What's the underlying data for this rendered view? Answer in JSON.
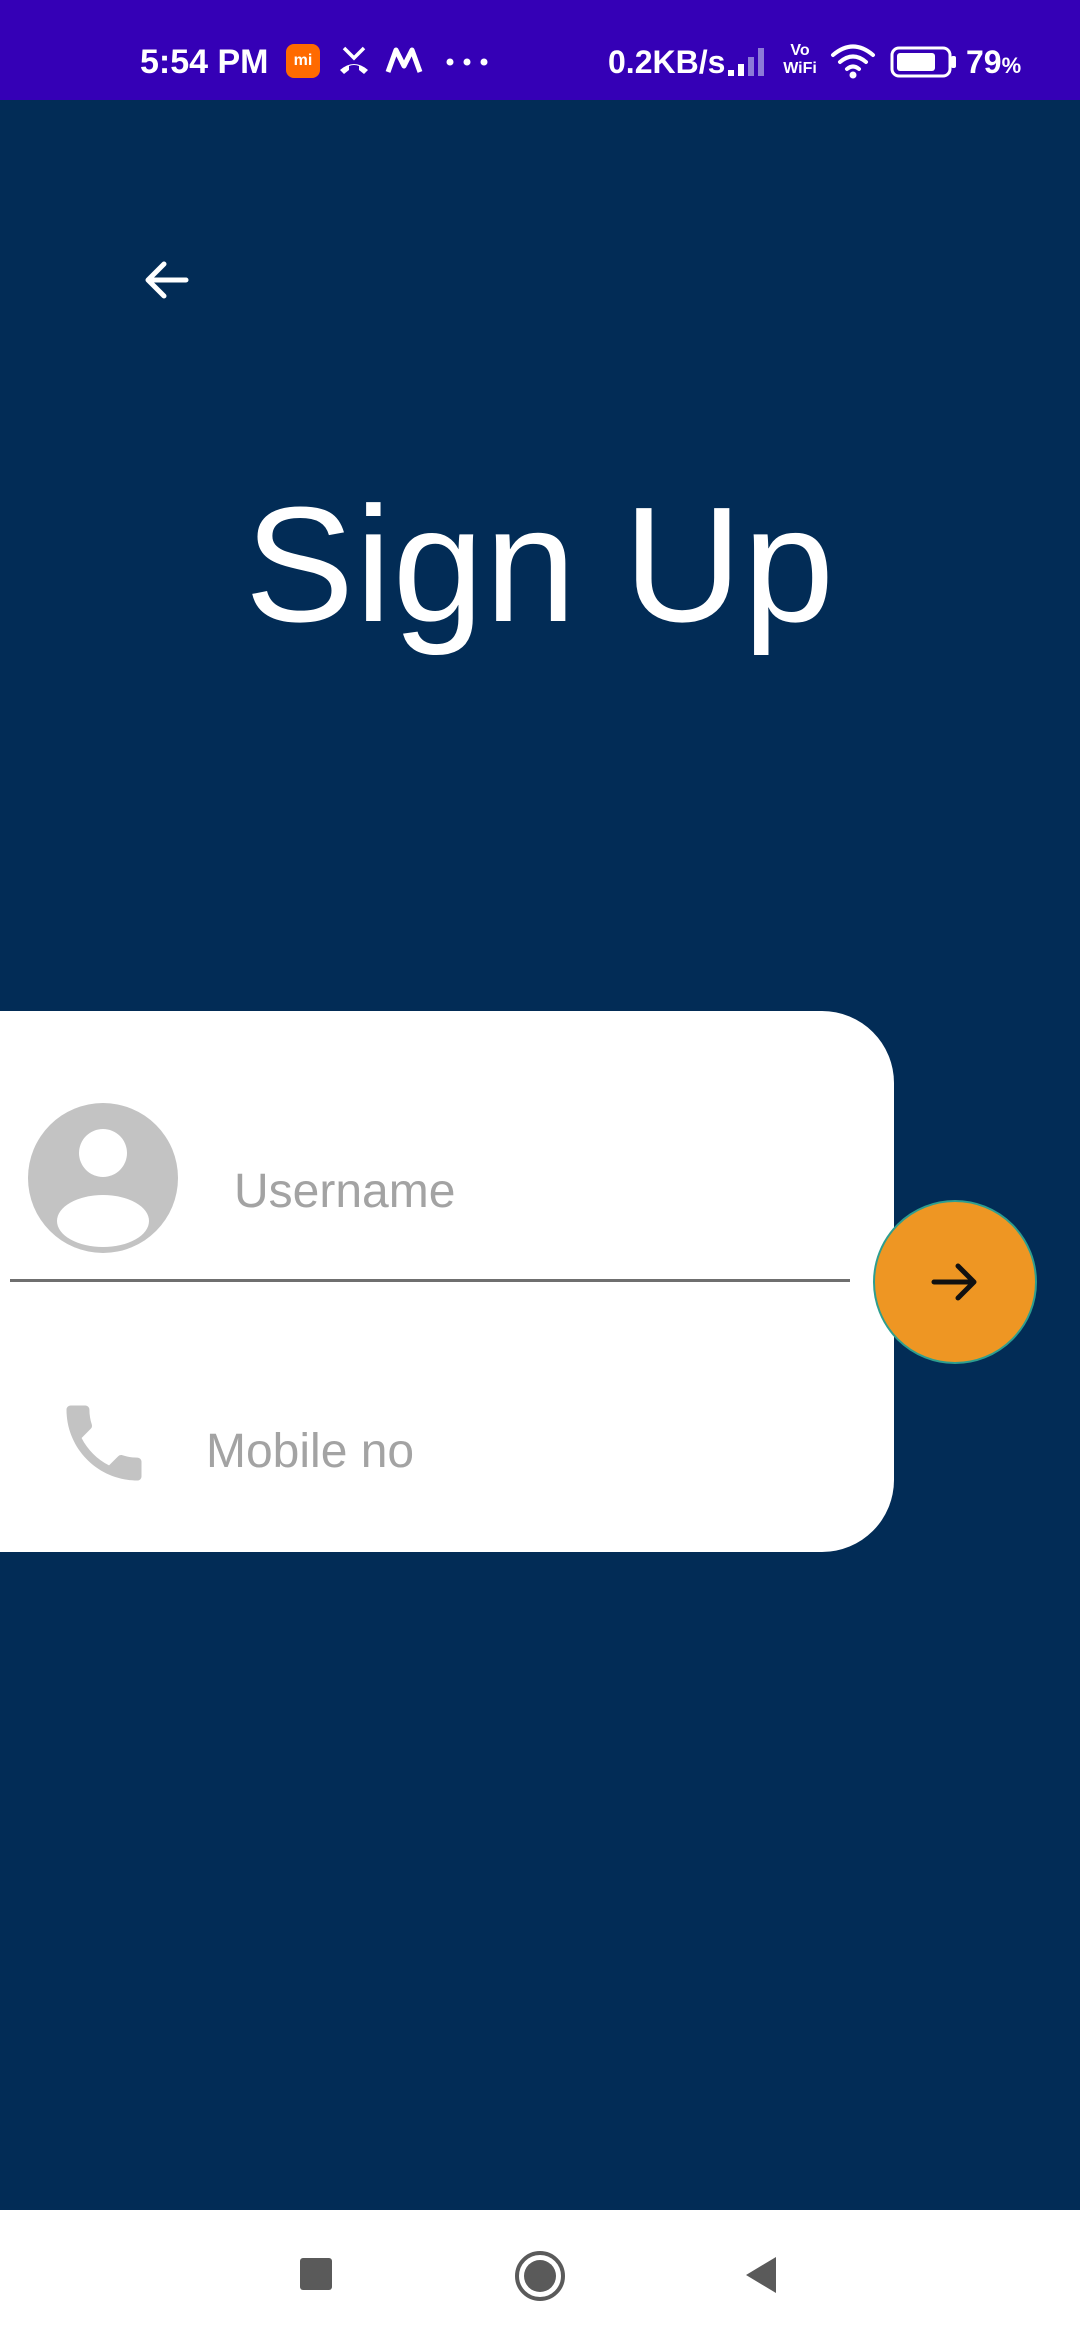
{
  "status_bar": {
    "time": "5:54 PM",
    "mi_badge": "mi",
    "net_speed": "0.2KB/s",
    "vowifi_top": "Vo",
    "vowifi_bottom": "WiFi",
    "battery_percent": "79",
    "battery_unit": "%",
    "battery_level": 0.79,
    "icons": [
      "mi-app-icon",
      "missed-call-icon",
      "m-app-icon",
      "more-dots-icon",
      "signal-icon",
      "vowifi-icon",
      "wifi-icon",
      "battery-icon"
    ]
  },
  "header": {
    "back_icon": "arrow-left-icon",
    "title": "Sign Up"
  },
  "form": {
    "username_placeholder": "Username",
    "username_value": "",
    "mobile_placeholder": "Mobile no",
    "mobile_value": "",
    "avatar_icon": "person-icon",
    "phone_icon": "phone-icon"
  },
  "next_button": {
    "icon": "arrow-right-icon"
  },
  "nav_bar": {
    "icons": [
      "recents-square-icon",
      "home-circle-icon",
      "back-triangle-icon"
    ]
  },
  "colors": {
    "status_bar": "#3500b6",
    "background": "#022c56",
    "card": "#ffffff",
    "accent": "#ee9623",
    "placeholder": "#a3a3a3",
    "icon_gray": "#c3c3c3"
  }
}
